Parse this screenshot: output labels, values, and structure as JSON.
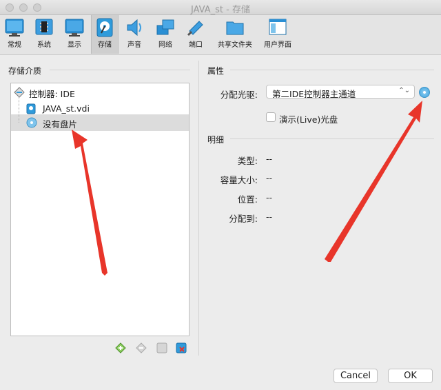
{
  "window": {
    "title": "JAVA_st - 存储"
  },
  "toolbar": {
    "items": [
      {
        "label": "常规",
        "icon": "monitor-icon"
      },
      {
        "label": "系统",
        "icon": "chip-icon"
      },
      {
        "label": "显示",
        "icon": "display-icon"
      },
      {
        "label": "存储",
        "icon": "hard-disk-icon"
      },
      {
        "label": "声音",
        "icon": "speaker-icon"
      },
      {
        "label": "网络",
        "icon": "network-icon"
      },
      {
        "label": "端口",
        "icon": "serial-port-icon"
      },
      {
        "label": "共享文件夹",
        "icon": "folder-icon"
      },
      {
        "label": "用户界面",
        "icon": "window-icon"
      }
    ],
    "active": "存储"
  },
  "left": {
    "title": "存储介质",
    "tree": [
      {
        "label": "控制器: IDE",
        "icon": "controller-icon"
      },
      {
        "label": "JAVA_st.vdi",
        "icon": "hard-disk-icon"
      },
      {
        "label": "没有盘片",
        "icon": "optical-disc-icon",
        "selected": true
      }
    ]
  },
  "right": {
    "attributes_title": "属性",
    "drive_label": "分配光驱:",
    "drive_value": "第二IDE控制器主通道",
    "live_cd_label": "演示(Live)光盘",
    "details_title": "明细",
    "details": [
      {
        "label": "类型:",
        "value": "--"
      },
      {
        "label": "容量大小:",
        "value": "--"
      },
      {
        "label": "位置:",
        "value": "--"
      },
      {
        "label": "分配到:",
        "value": "--"
      }
    ]
  },
  "buttons": {
    "cancel": "Cancel",
    "ok": "OK"
  },
  "colors": {
    "accent": "#2f9bdb",
    "arrow": "#e8352a",
    "selection": "#dcdcdc"
  }
}
